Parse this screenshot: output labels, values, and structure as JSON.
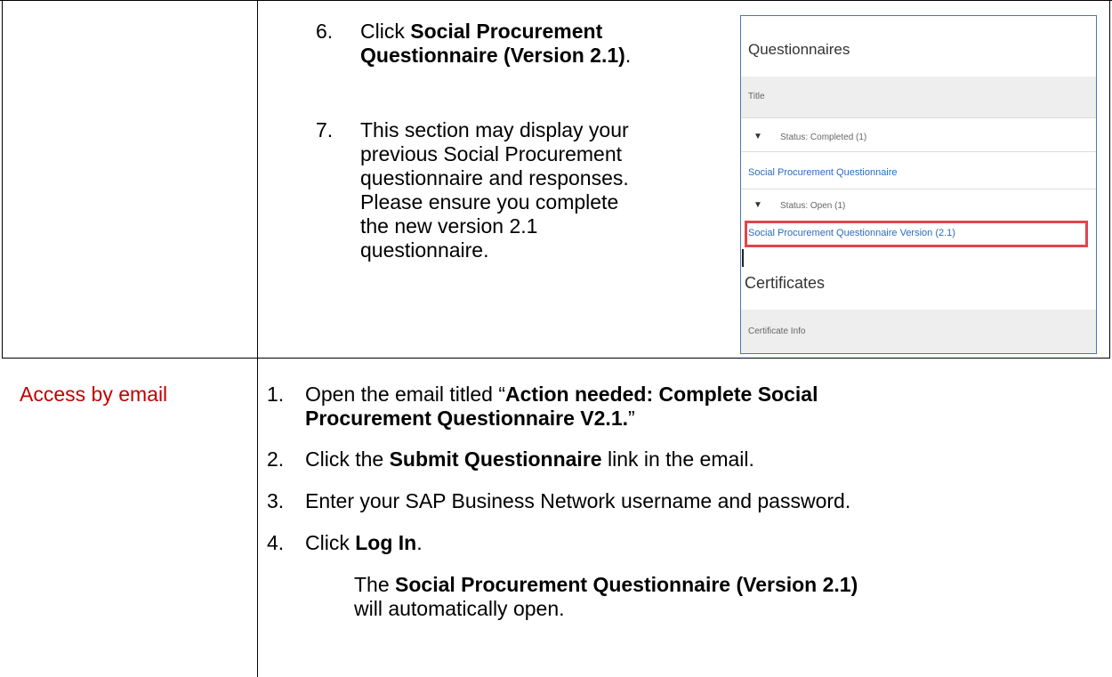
{
  "upper_row": {
    "steps": [
      {
        "number": "6.",
        "pre": "Click ",
        "bold": "Social Procurement Questionnaire (Version 2.1)",
        "post": "."
      },
      {
        "number": "7.",
        "lines": [
          "This section may display your",
          "previous Social Procurement",
          "questionnaire and responses.",
          "Please ensure you complete",
          "the new version 2.1",
          "questionnaire."
        ]
      }
    ],
    "screenshot": {
      "questionnaires_heading": "Questionnaires",
      "title_column": "Title",
      "status_completed": "Status: Completed  (1)",
      "completed_link": "Social Procurement Questionnaire",
      "status_open": "Status: Open  (1)",
      "open_link": "Social Procurement Questionnaire Version (2.1)",
      "certificates_heading": "Certificates",
      "certificate_info_column": "Certificate Info",
      "expand_icon": "triangle-down-icon",
      "highlight_color": "#e0454c",
      "link_color": "#2a6cbf"
    }
  },
  "lower_row": {
    "label": "Access by email",
    "label_color": "#c00000",
    "steps": [
      {
        "number": "1.",
        "pre": "Open the email titled “",
        "bold": "Action needed: Complete Social Procurement Questionnaire V2.1.",
        "post": "”"
      },
      {
        "number": "2.",
        "pre": "Click the ",
        "bold": "Submit Questionnaire",
        "post": " link in the email."
      },
      {
        "number": "3.",
        "text": "Enter your SAP Business Network username and password."
      },
      {
        "number": "4.",
        "pre": "Click ",
        "bold": "Log In",
        "post": "."
      }
    ],
    "note": {
      "pre": "The ",
      "bold": "Social Procurement Questionnaire (Version 2.1)",
      "post": " will automatically open."
    }
  }
}
